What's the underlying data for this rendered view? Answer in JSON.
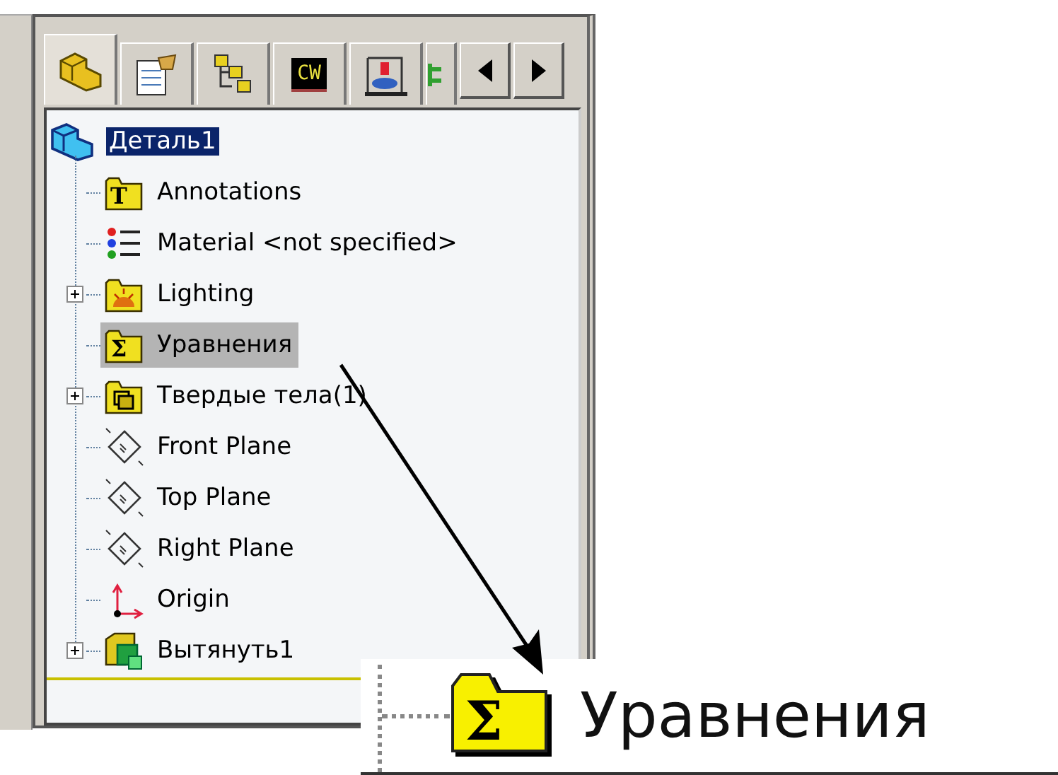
{
  "tabs": [
    {
      "kind": "features",
      "selected": true
    },
    {
      "kind": "properties",
      "selected": false
    },
    {
      "kind": "configurations",
      "selected": false
    },
    {
      "kind": "cw",
      "glyph": "CW",
      "selected": false
    },
    {
      "kind": "display",
      "selected": false
    },
    {
      "kind": "partial",
      "selected": false
    }
  ],
  "tab_scroll": [
    {
      "kind": "left"
    },
    {
      "kind": "right"
    }
  ],
  "tree": {
    "root": {
      "label": "Деталь1",
      "selected": true
    },
    "children": [
      {
        "label": "Annotations",
        "kind": "annotations",
        "glyph": "T",
        "expandable": false,
        "selected": false
      },
      {
        "label": "Material <not specified>",
        "kind": "material",
        "expandable": false,
        "selected": false
      },
      {
        "label": "Lighting",
        "kind": "lighting",
        "expandable": true,
        "selected": false
      },
      {
        "label": "Уравнения",
        "kind": "equations",
        "glyph": "Σ",
        "expandable": false,
        "selected": true
      },
      {
        "label": "Твердые тела(1)",
        "kind": "bodies",
        "expandable": true,
        "selected": false
      },
      {
        "label": "Front Plane",
        "kind": "plane",
        "expandable": false,
        "selected": false
      },
      {
        "label": "Top Plane",
        "kind": "plane",
        "expandable": false,
        "selected": false
      },
      {
        "label": "Right Plane",
        "kind": "plane",
        "expandable": false,
        "selected": false
      },
      {
        "label": "Origin",
        "kind": "origin",
        "expandable": false,
        "selected": false
      },
      {
        "label": "Вытянуть1",
        "kind": "extrude",
        "expandable": true,
        "selected": false
      }
    ]
  },
  "magnified": {
    "label": "Уравнения",
    "glyph": "Σ"
  }
}
